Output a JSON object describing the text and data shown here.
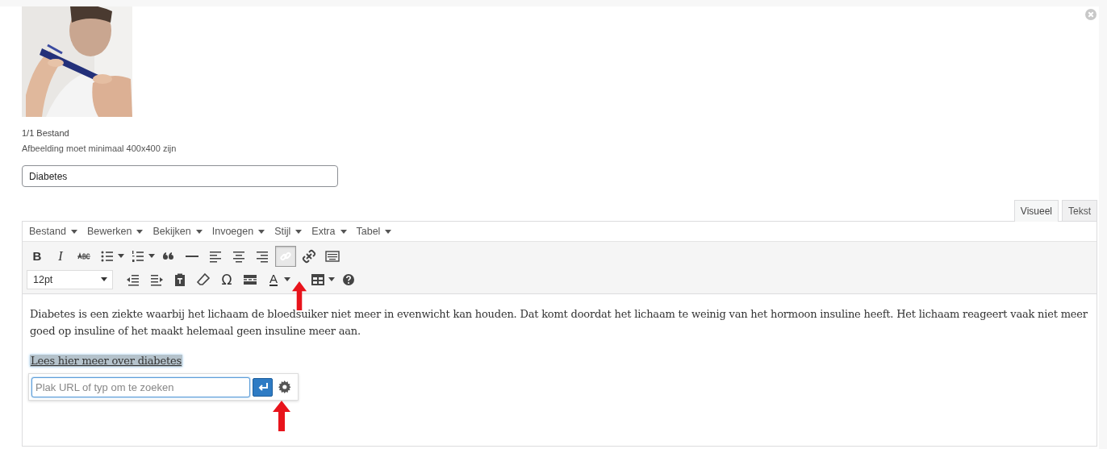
{
  "upload": {
    "count": "1/1 Bestand",
    "hint": "Afbeelding moet minimaal 400x400 zijn"
  },
  "title_field": {
    "value": "Diabetes"
  },
  "editor_tabs": [
    {
      "label": "Visueel",
      "selected": true
    },
    {
      "label": "Tekst",
      "selected": false
    }
  ],
  "menu": [
    "Bestand",
    "Bewerken",
    "Bekijken",
    "Invoegen",
    "Stijl",
    "Extra",
    "Tabel"
  ],
  "toolbar_rows": [
    [
      {
        "kind": "bold",
        "label": "B",
        "selected": false
      },
      {
        "kind": "italic",
        "label": "I",
        "selected": false
      },
      {
        "kind": "strike",
        "selected": false
      },
      {
        "kind": "bullets",
        "selected": false
      },
      {
        "kind": "caret",
        "selected": false
      },
      {
        "kind": "numbers",
        "selected": false
      },
      {
        "kind": "caret",
        "selected": false
      },
      {
        "kind": "quote",
        "selected": false
      },
      {
        "kind": "hr",
        "selected": false
      },
      {
        "kind": "align-left",
        "selected": false
      },
      {
        "kind": "align-center",
        "selected": false
      },
      {
        "kind": "align-right",
        "selected": false
      },
      {
        "kind": "link",
        "selected": true
      },
      {
        "kind": "unlink",
        "selected": false
      },
      {
        "kind": "keyboard",
        "selected": false
      }
    ],
    [
      {
        "kind": "select",
        "label": "12pt"
      },
      {
        "kind": "outdent",
        "selected": false
      },
      {
        "kind": "indent",
        "selected": false
      },
      {
        "kind": "paste",
        "selected": false
      },
      {
        "kind": "eraser",
        "selected": false
      },
      {
        "kind": "symbol",
        "label": "Ω",
        "selected": false
      },
      {
        "kind": "more",
        "selected": false
      },
      {
        "kind": "color",
        "label": "A",
        "selected": false
      },
      {
        "kind": "caret",
        "selected": false
      },
      {
        "kind": "table",
        "selected": false
      },
      {
        "kind": "caret",
        "selected": false
      },
      {
        "kind": "help",
        "selected": false
      }
    ]
  ],
  "content": {
    "paragraph": "Diabetes is een ziekte waarbij het lichaam de bloedsuiker niet meer in evenwicht kan houden. Dat komt doordat het lichaam te weinig van het hormoon insuline heeft. Het lichaam reageert vaak niet meer goed op insuline of het maakt helemaal geen insuline meer aan.",
    "link_text": "Lees hier meer over diabetes"
  },
  "link_popup": {
    "placeholder": "Plak URL of typ om te zoeken"
  }
}
